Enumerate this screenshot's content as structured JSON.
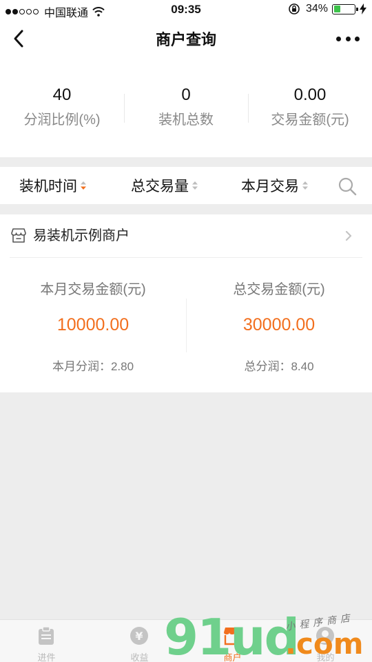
{
  "status_bar": {
    "carrier": "中国联通",
    "time": "09:35",
    "battery": "34%",
    "battery_level": 0.34,
    "signal_bars_filled": 2,
    "signal_bars_total": 5
  },
  "nav": {
    "title": "商户查询"
  },
  "stats": [
    {
      "value": "40",
      "label": "分润比例(%)"
    },
    {
      "value": "0",
      "label": "装机总数"
    },
    {
      "value": "0.00",
      "label": "交易金额(元)"
    }
  ],
  "filters": [
    {
      "label": "装机时间",
      "sort": "desc"
    },
    {
      "label": "总交易量",
      "sort": "none"
    },
    {
      "label": "本月交易",
      "sort": "none"
    }
  ],
  "merchant": {
    "name": "易装机示例商户",
    "monthly": {
      "label": "本月交易金额(元)",
      "value": "10000.00",
      "sub": "本月分润：2.80"
    },
    "total": {
      "label": "总交易金额(元)",
      "value": "30000.00",
      "sub": "总分润：8.40"
    }
  },
  "tabs": [
    {
      "label": "进件",
      "icon": "clipboard-icon"
    },
    {
      "label": "收益",
      "icon": "yen-coin-icon"
    },
    {
      "label": "商户",
      "icon": "shop-icon",
      "active": true
    },
    {
      "label": "我的",
      "icon": "user-icon"
    }
  ],
  "watermark": {
    "number": "91ud",
    "domain": ".com",
    "tagline": "小程序商店"
  },
  "colors": {
    "accent": "#f26f1e",
    "battery": "#3cc24a",
    "watermark_green": "#6fd08c",
    "watermark_orange": "#f08a1c"
  }
}
